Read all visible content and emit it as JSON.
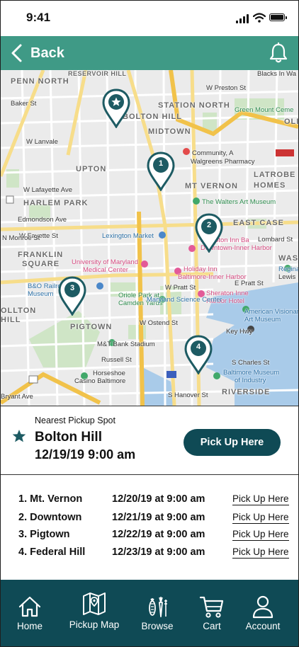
{
  "status_bar": {
    "time": "9:41"
  },
  "header": {
    "back_label": "Back"
  },
  "map": {
    "neighborhoods": [
      "PENN NORTH",
      "RESERVOIR HILL",
      "STATION NORTH",
      "BOLTON HILL",
      "MIDTOWN",
      "UPTON",
      "MT VERNON",
      "HARLEM PARK",
      "LATROBE",
      "HOMES",
      "EAST CASE",
      "FRANKLIN",
      "SQUARE",
      "PIGTOWN",
      "RIVERSIDE",
      "WASH",
      "OLI",
      "OLLTON",
      "HILL"
    ],
    "pois": {
      "blacks": "Blacks In Wa",
      "green_mount": "Green Mount Ceme",
      "community": "Community, A",
      "walgreens": "Walgreens Pharmacy",
      "walters": "The Walters Art Museum",
      "lexington": "Lexington Market",
      "hampton1": "Hampton Inn Ba",
      "hampton2": "Downtown-Inner Harbor",
      "umd1": "University of Maryland",
      "umd2": "Medical Center",
      "holiday1": "Holiday Inn",
      "holiday2": "Baltimore-Inner Harbor",
      "bo1": "B&O Railroa",
      "bo2": "Museum",
      "oriole1": "Oriole Park at",
      "oriole2": "Camden Yards",
      "sheraton1": "Sheraton Inne",
      "sheraton2": "Harbor Hotel",
      "avm1": "American Visionar",
      "avm2": "Art Museum",
      "science": "Maryland Science Center",
      "regina1": "Regina",
      "regina2": "Lewis",
      "keyhwy": "Key Hwy",
      "mt_bank": "M&T Bank Stadium",
      "horseshoe1": "Horseshoe",
      "horseshoe2": "Casino Baltimore",
      "bmi1": "Baltimore Museum",
      "bmi2": "of Industry",
      "wlafayette": "W Lafayette Ave",
      "edmondson": "Edmondson Ave",
      "w_fayette": "W Fayette St",
      "w_pratt": "W Pratt St",
      "e_pratt": "E Pratt St",
      "s_hanover": "S Hanover St",
      "w_ostend": "W Ostend St",
      "s_charles": "S Charles St",
      "bryant": "Bryant Ave",
      "russell": "Russell St",
      "w_preston": "W Preston St",
      "w_lanvale": "W Lanvale",
      "baker": "Baker St",
      "morrow": "N Monroe St",
      "e_lombard": "Lombard St"
    },
    "pins": [
      {
        "label": "",
        "icon": "star-icon"
      },
      {
        "label": "1"
      },
      {
        "label": "2"
      },
      {
        "label": "3"
      },
      {
        "label": "4"
      }
    ]
  },
  "nearest": {
    "caption": "Nearest Pickup Spot",
    "name": "Bolton Hill",
    "time": "12/19/19 9:00 am",
    "button": "Pick Up Here"
  },
  "pickups": [
    {
      "location": "1. Mt. Vernon",
      "when": "12/20/19 at 9:00 am",
      "link": "Pick Up Here"
    },
    {
      "location": "2. Downtown",
      "when": "12/21/19 at 9:00 am",
      "link": "Pick Up Here"
    },
    {
      "location": "3. Pigtown",
      "when": "12/22/19 at 9:00 am",
      "link": "Pick Up Here"
    },
    {
      "location": "4. Federal Hill",
      "when": "12/23/19 at 9:00 am",
      "link": "Pick Up Here"
    }
  ],
  "nav": {
    "items": [
      {
        "label": "Home",
        "icon": "home-icon"
      },
      {
        "label": "Pickup Map",
        "icon": "map-icon"
      },
      {
        "label": "Browse",
        "icon": "produce-icon"
      },
      {
        "label": "Cart",
        "icon": "cart-icon"
      },
      {
        "label": "Account",
        "icon": "account-icon"
      }
    ]
  },
  "colors": {
    "header": "#3f9a86",
    "nav": "#0f4a55",
    "pin": "#1d5b63",
    "button": "#0f4a55"
  }
}
